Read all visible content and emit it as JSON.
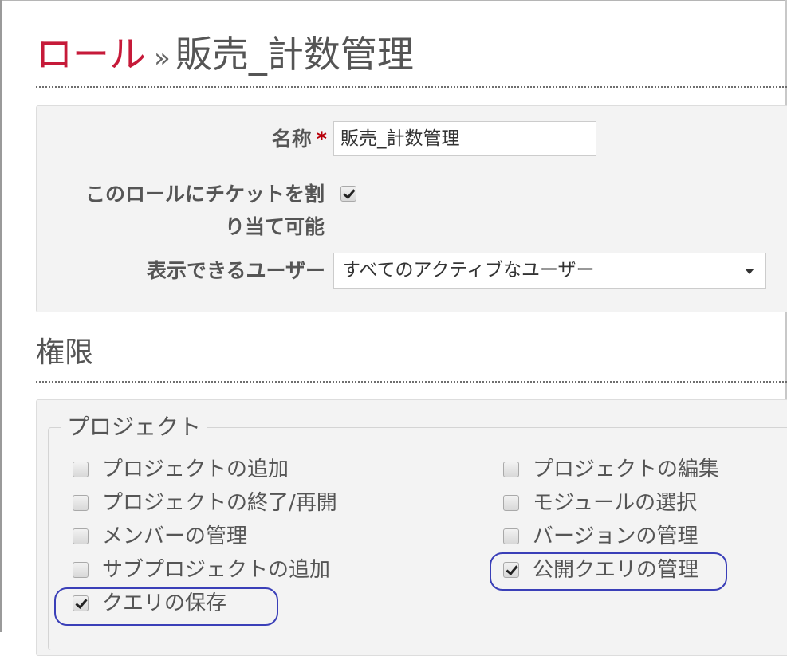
{
  "header": {
    "breadcrumb": "ロール",
    "separator": "»",
    "role_name": "販売_計数管理"
  },
  "form": {
    "name_label": "名称",
    "required_mark": "*",
    "name_value": "販売_計数管理",
    "assignable_label_line1": "このロールにチケットを割",
    "assignable_label_line2": "り当て可能",
    "assignable_checked": true,
    "visible_users_label": "表示できるユーザー",
    "visible_users_value": "すべてのアクティブなユーザー"
  },
  "permissions": {
    "heading": "権限",
    "groups": [
      {
        "legend": "プロジェクト",
        "items": [
          {
            "label": "プロジェクトの追加",
            "checked": false
          },
          {
            "label": "プロジェクトの編集",
            "checked": false
          },
          {
            "label": "プロジェクトの終了/再開",
            "checked": false
          },
          {
            "label": "モジュールの選択",
            "checked": false
          },
          {
            "label": "メンバーの管理",
            "checked": false
          },
          {
            "label": "バージョンの管理",
            "checked": false
          },
          {
            "label": "サブプロジェクトの追加",
            "checked": false
          },
          {
            "label": "公開クエリの管理",
            "checked": true
          },
          {
            "label": "クエリの保存",
            "checked": true
          }
        ]
      }
    ]
  },
  "colors": {
    "breadcrumb": "#c61a39",
    "required": "#b8000a",
    "highlight": "#3a3fb8",
    "panel": "#f3f3f3"
  }
}
